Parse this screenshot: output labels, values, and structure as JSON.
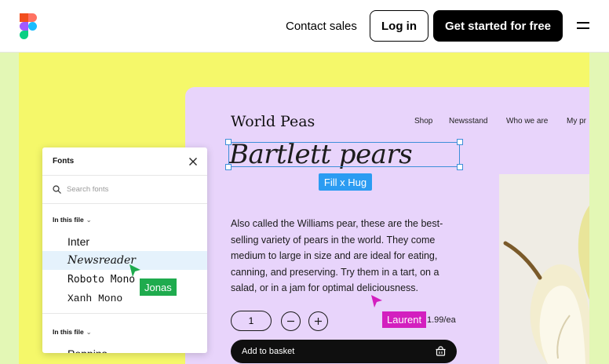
{
  "header": {
    "contact_label": "Contact sales",
    "login_label": "Log in",
    "start_label": "Get started for free",
    "logo_icon": "figma-logo-icon",
    "menu_icon": "hamburger-menu-icon"
  },
  "colors": {
    "hero_background": "#e3f7b5",
    "hero_yellow": "#f5f86a",
    "card_lavender": "#e8d4fb",
    "selection_blue": "#3d8fd9",
    "fill_tag_blue": "#2b9cf2",
    "laurent_magenta": "#d31fbf",
    "jonas_green": "#1fab4e"
  },
  "shop": {
    "brand": "World Peas",
    "nav": [
      "Shop",
      "Newsstand",
      "Who we are",
      "My pr"
    ],
    "product_title": "Bartlett pears",
    "fill_tag": "Fill x Hug",
    "description": "Also called the Williams pear, these are the best-selling variety of pears in the world. They come medium to large in size and are ideal for eating, canning, and preserving. Try them in a tart, on a salad, or in a jam for optimal deliciousness.",
    "quantity": "1",
    "minus_icon": "minus-icon",
    "plus_icon": "plus-icon",
    "price": "1.99/ea",
    "add_to_basket": "Add to basket",
    "basket_icon": "basket-icon"
  },
  "cursors": {
    "laurent": "Laurent",
    "jonas": "Jonas"
  },
  "fonts_panel": {
    "title": "Fonts",
    "search_placeholder": "Search fonts",
    "section_label": "In this file",
    "section_label_2": "In this file",
    "items": [
      {
        "label": "Inter"
      },
      {
        "label": "Newsreader",
        "selected": true
      },
      {
        "label": "Roboto Mono"
      },
      {
        "label": "Xanh Mono"
      }
    ],
    "partial_item": "Poppins"
  }
}
